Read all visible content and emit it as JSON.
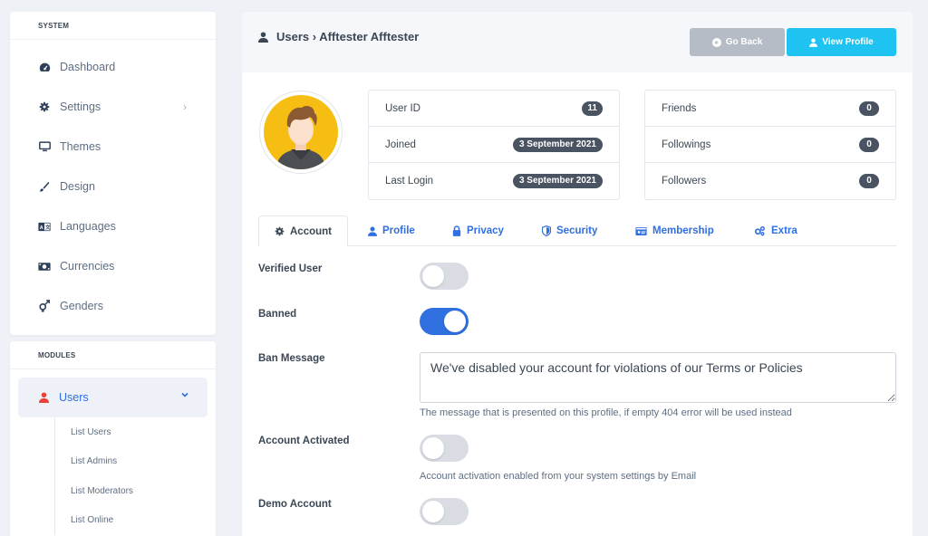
{
  "sidebar": {
    "system_header": "SYSTEM",
    "system_items": [
      {
        "label": "Dashboard",
        "icon": "dashboard-icon"
      },
      {
        "label": "Settings",
        "icon": "gear-icon"
      },
      {
        "label": "Themes",
        "icon": "desktop-icon"
      },
      {
        "label": "Design",
        "icon": "brush-icon"
      },
      {
        "label": "Languages",
        "icon": "language-icon"
      },
      {
        "label": "Currencies",
        "icon": "money-icon"
      },
      {
        "label": "Genders",
        "icon": "genders-icon"
      }
    ],
    "modules_header": "MODULES",
    "users_label": "Users",
    "users_subitems": [
      "List Users",
      "List Admins",
      "List Moderators",
      "List Online"
    ]
  },
  "header": {
    "breadcrumb": "Users › Afftester Afftester",
    "go_back_label": "Go Back",
    "view_profile_label": "View Profile"
  },
  "stats_left": [
    {
      "label": "User ID",
      "value": "11"
    },
    {
      "label": "Joined",
      "value": "3 September 2021"
    },
    {
      "label": "Last Login",
      "value": "3 September 2021"
    }
  ],
  "stats_right": [
    {
      "label": "Friends",
      "value": "0"
    },
    {
      "label": "Followings",
      "value": "0"
    },
    {
      "label": "Followers",
      "value": "0"
    }
  ],
  "tabs": [
    {
      "label": "Account",
      "icon": "gear-icon",
      "active": true
    },
    {
      "label": "Profile",
      "icon": "user-icon"
    },
    {
      "label": "Privacy",
      "icon": "lock-icon"
    },
    {
      "label": "Security",
      "icon": "shield-icon"
    },
    {
      "label": "Membership",
      "icon": "id-card-icon"
    },
    {
      "label": "Extra",
      "icon": "cogs-icon"
    }
  ],
  "form": {
    "verified_label": "Verified User",
    "verified_on": false,
    "banned_label": "Banned",
    "banned_on": true,
    "ban_message_label": "Ban Message",
    "ban_message_value": "We've disabled your account for violations of our Terms or Policies",
    "ban_message_help": "The message that is presented on this profile, if empty 404 error will be used instead",
    "activated_label": "Account Activated",
    "activated_on": false,
    "activated_help": "Account activation enabled from your system settings by Email",
    "demo_label": "Demo Account",
    "demo_on": false
  },
  "colors": {
    "accent": "#2f6fe0",
    "cyan_button": "#1ec3f2",
    "grey_button": "#b6bcc5",
    "avatar_bg": "#f6be13",
    "pill": "#495361"
  }
}
